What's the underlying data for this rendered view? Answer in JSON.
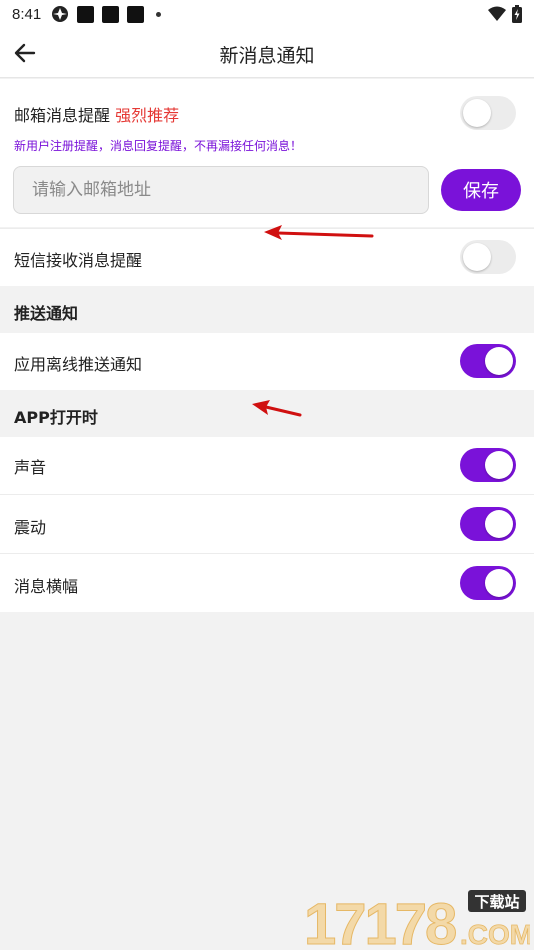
{
  "status_bar": {
    "time": "8:41"
  },
  "header": {
    "title": "新消息通知"
  },
  "email_section": {
    "label": "邮箱消息提醒",
    "label_highlight": "强烈推荐",
    "hint": "新用户注册提醒，消息回复提醒，不再漏接任何消息！",
    "input_placeholder": "请输入邮箱地址",
    "input_value": "",
    "save_label": "保存",
    "enabled": false
  },
  "sms_section": {
    "label": "短信接收消息提醒",
    "enabled": false
  },
  "push_group": {
    "title": "推送通知",
    "items": [
      {
        "label": "应用离线推送通知",
        "enabled": true
      }
    ]
  },
  "app_open_group": {
    "title": "APP打开时",
    "items": [
      {
        "label": "声音",
        "enabled": true
      },
      {
        "label": "震动",
        "enabled": true
      },
      {
        "label": "消息横幅",
        "enabled": true
      }
    ]
  },
  "watermark": {
    "text": "17178",
    "sub": "下载站",
    "domain": ".COM"
  },
  "colors": {
    "accent": "#7a12d9",
    "highlight": "#e53935",
    "annotation": "#d01010"
  }
}
